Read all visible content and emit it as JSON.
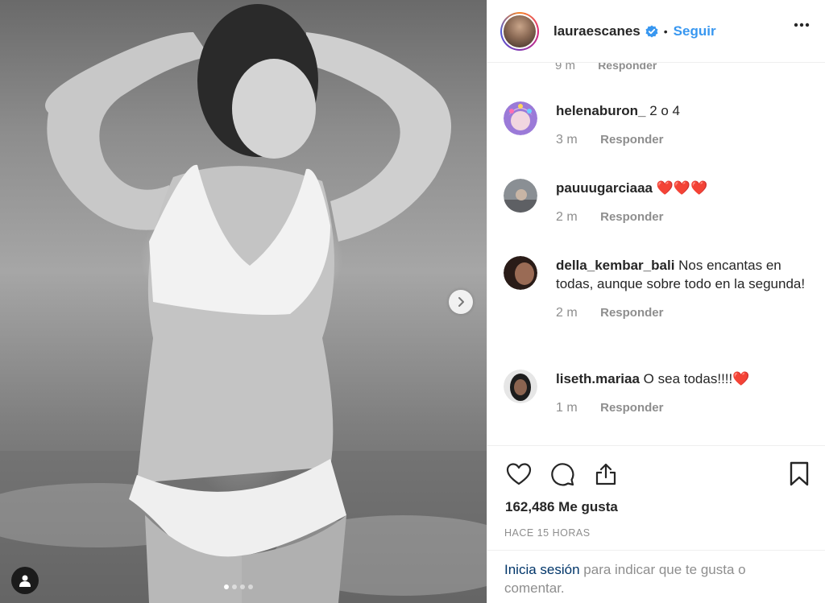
{
  "header": {
    "username": "lauraescanes",
    "separator": "•",
    "follow_label": "Seguir"
  },
  "partial": {
    "time": "9 m",
    "reply": "Responder"
  },
  "comments": [
    {
      "username": "helenaburon_",
      "text": " 2 o 4",
      "time": "3 m",
      "reply": "Responder"
    },
    {
      "username": "pauuugarciaaa",
      "text": " ❤️❤️❤️",
      "time": "2 m",
      "reply": "Responder"
    },
    {
      "username": "della_kembar_bali",
      "text": " Nos encantas en todas, aunque sobre todo en la segunda!",
      "time": "2 m",
      "reply": "Responder"
    },
    {
      "username": "liseth.mariaa",
      "text": " O sea todas!!!!❤️",
      "time": "1 m",
      "reply": "Responder"
    }
  ],
  "likes": "162,486 Me gusta",
  "posted": "HACE 15 HORAS",
  "login": {
    "link": "Inicia sesión",
    "rest": " para indicar que te gusta o comentar."
  },
  "colors": {
    "link_blue": "#3897f0",
    "muted": "#8e8e8e",
    "text": "#262626",
    "heart_red": "#e0245e"
  },
  "icons": [
    "chevron-right-icon",
    "user-tag-icon",
    "verified-icon",
    "more-icon",
    "heart-icon",
    "comment-icon",
    "share-icon",
    "bookmark-icon"
  ],
  "carousel": {
    "pages": 4,
    "active_page": 1
  }
}
